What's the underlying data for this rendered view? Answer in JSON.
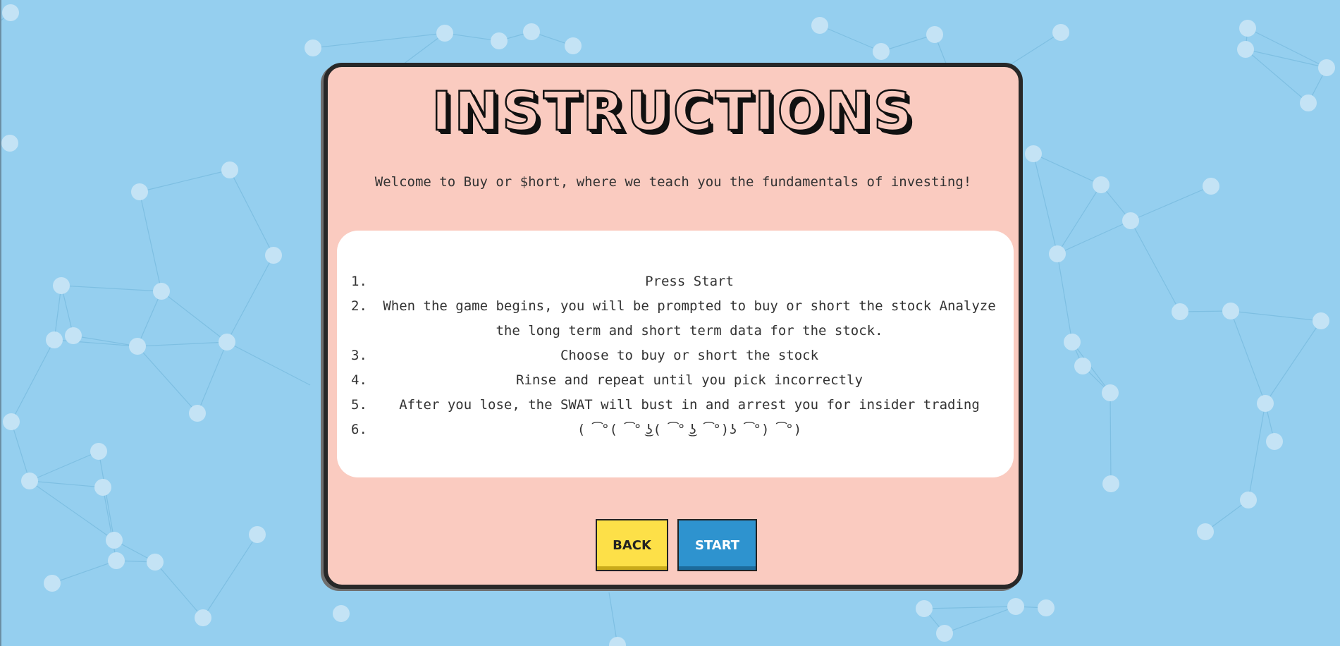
{
  "title": "INSTRUCTIONS",
  "welcome": "Welcome to Buy or $hort, where we teach you the fundamentals of investing!",
  "steps": [
    {
      "num": "1.",
      "text": "Press Start"
    },
    {
      "num": "2.",
      "text": "When the game begins, you will be prompted to buy or short the stock Analyze the long term and short term data for the stock."
    },
    {
      "num": "3.",
      "text": "Choose to buy or short the stock"
    },
    {
      "num": "4.",
      "text": "Rinse and repeat until you pick incorrectly"
    },
    {
      "num": "5.",
      "text": "After you lose, the SWAT will bust in and arrest you for insider trading"
    },
    {
      "num": "6.",
      "text": "( ͡°( ͡° ͜ʖ( ͡° ͜ʖ ͡°)ʖ ͡°) ͡°)"
    }
  ],
  "buttons": {
    "back": "BACK",
    "start": "START"
  },
  "colors": {
    "background": "#95cfef",
    "card": "#facbc0",
    "back_button": "#fde048",
    "start_button": "#2e93cf"
  }
}
